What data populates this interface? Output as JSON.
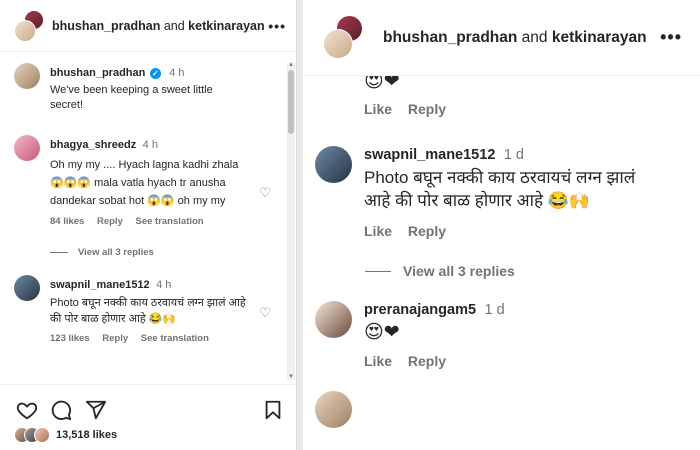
{
  "post_header": {
    "user1": "bhushan_pradhan",
    "joiner": "and",
    "user2": "ketkinarayan",
    "more_label": "•••"
  },
  "caption": {
    "username": "bhushan_pradhan",
    "time": "4 h",
    "text": "We've been keeping a sweet little secret!"
  },
  "comments_left": [
    {
      "username": "bhagya_shreedz",
      "time": "4 h",
      "text": "Oh my my .... Hyach lagna kadhi zhala 😱😱😱 mala vatla hyach tr anusha dandekar sobat hot 😱😱 oh my my",
      "likes": "84 likes",
      "reply": "Reply",
      "translate": "See translation",
      "view_replies": "View all 3 replies"
    },
    {
      "username": "swapnil_mane1512",
      "time": "4 h",
      "text": "Photo बघून नक्की काय ठरवायचं लग्न झालं आहे की पोर बाळ होणार आहे 😂🙌",
      "likes": "123 likes",
      "reply": "Reply",
      "translate": "See translation"
    }
  ],
  "actions": {
    "likes_count": "13,518",
    "likes_word": "likes"
  },
  "comments_right": [
    {
      "emojis": "😍❤",
      "like": "Like",
      "reply": "Reply"
    },
    {
      "username": "swapnil_mane1512",
      "time": "1 d",
      "text": "Photo बघून नक्की काय ठरवायचं लग्न झालं आहे की पोर बाळ होणार आहे 😂🙌",
      "like": "Like",
      "reply": "Reply",
      "view_replies": "View all 3 replies"
    },
    {
      "username": "preranajangam5",
      "time": "1 d",
      "emojis": "😍❤",
      "like": "Like",
      "reply": "Reply"
    }
  ]
}
